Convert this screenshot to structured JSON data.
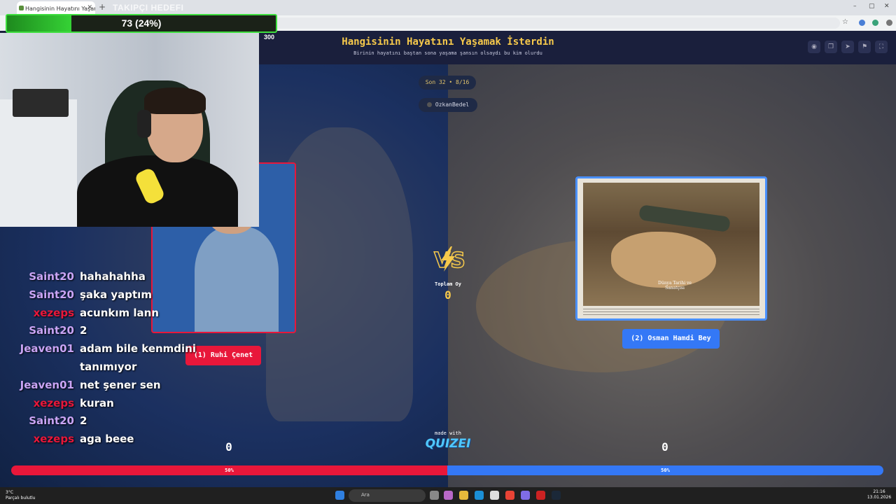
{
  "browser": {
    "tab_title": "Hangisinin Hayatını Yaşamak İs",
    "new_tab_symbol": "+",
    "close_symbol": "✕",
    "minimize_symbol": "–",
    "maximize_symbol": "▢",
    "window_close_symbol": "✕",
    "bookmark_symbol": "☆"
  },
  "stream": {
    "goal_title": "TAKIPÇI HEDEFI",
    "goal_text": "73 (24%)",
    "goal_progress": 0.24,
    "goal_target": "300"
  },
  "quiz": {
    "title": "Hangisinin Hayatını Yaşamak İsterdin",
    "subtitle": "Birinin hayatını baştan sona yaşama şansın olsaydı bu kim olurdu",
    "round": "Son 32 • 8/16",
    "creator": "OzkanBedel",
    "vs_text": "VS",
    "total_votes_label": "Toplam Oy",
    "total_votes": "0",
    "option1_label": "(1) Ruhi Çenet",
    "option2_label": "(2) Osman Hamdi Bey",
    "option2_caption": "Dünya Tarihi ve Sanatçısı",
    "score_left": "0",
    "score_right": "0",
    "percent_left": "50%",
    "percent_right": "50%",
    "share_left": 0.5,
    "made_with": "made with",
    "brand": "QUIZEI",
    "header_icons": [
      "eye-icon",
      "copy-icon",
      "send-icon",
      "flag-icon",
      "fullscreen-icon"
    ]
  },
  "chat": [
    {
      "user": "Saint20",
      "message": "hahahahha",
      "color": "#c9a4f5"
    },
    {
      "user": "Saint20",
      "message": "şaka yaptım",
      "color": "#c9a4f5"
    },
    {
      "user": "xezeps",
      "message": "acunkım lann",
      "color": "#e8173a"
    },
    {
      "user": "Saint20",
      "message": "2",
      "color": "#c9a4f5"
    },
    {
      "user": "Jeaven01",
      "message": "adam bile kenmdini",
      "color": "#c9a4f5"
    },
    {
      "user": "",
      "message": "tanımıyor",
      "color": "#c9a4f5"
    },
    {
      "user": "Jeaven01",
      "message": "net şener sen",
      "color": "#c9a4f5"
    },
    {
      "user": "xezeps",
      "message": "kuran",
      "color": "#e8173a"
    },
    {
      "user": "Saint20",
      "message": "2",
      "color": "#c9a4f5"
    },
    {
      "user": "xezeps",
      "message": "aga beee",
      "color": "#e8173a"
    }
  ],
  "taskbar": {
    "weather_temp": "3°C",
    "weather_desc": "Parçalı bulutlu",
    "search_placeholder": "Ara",
    "time": "21:16",
    "date": "13.01.2026"
  },
  "colors": {
    "red": "#e8173a",
    "blue": "#3478f6",
    "gold": "#f6c94b",
    "goal_green": "#35d235"
  }
}
